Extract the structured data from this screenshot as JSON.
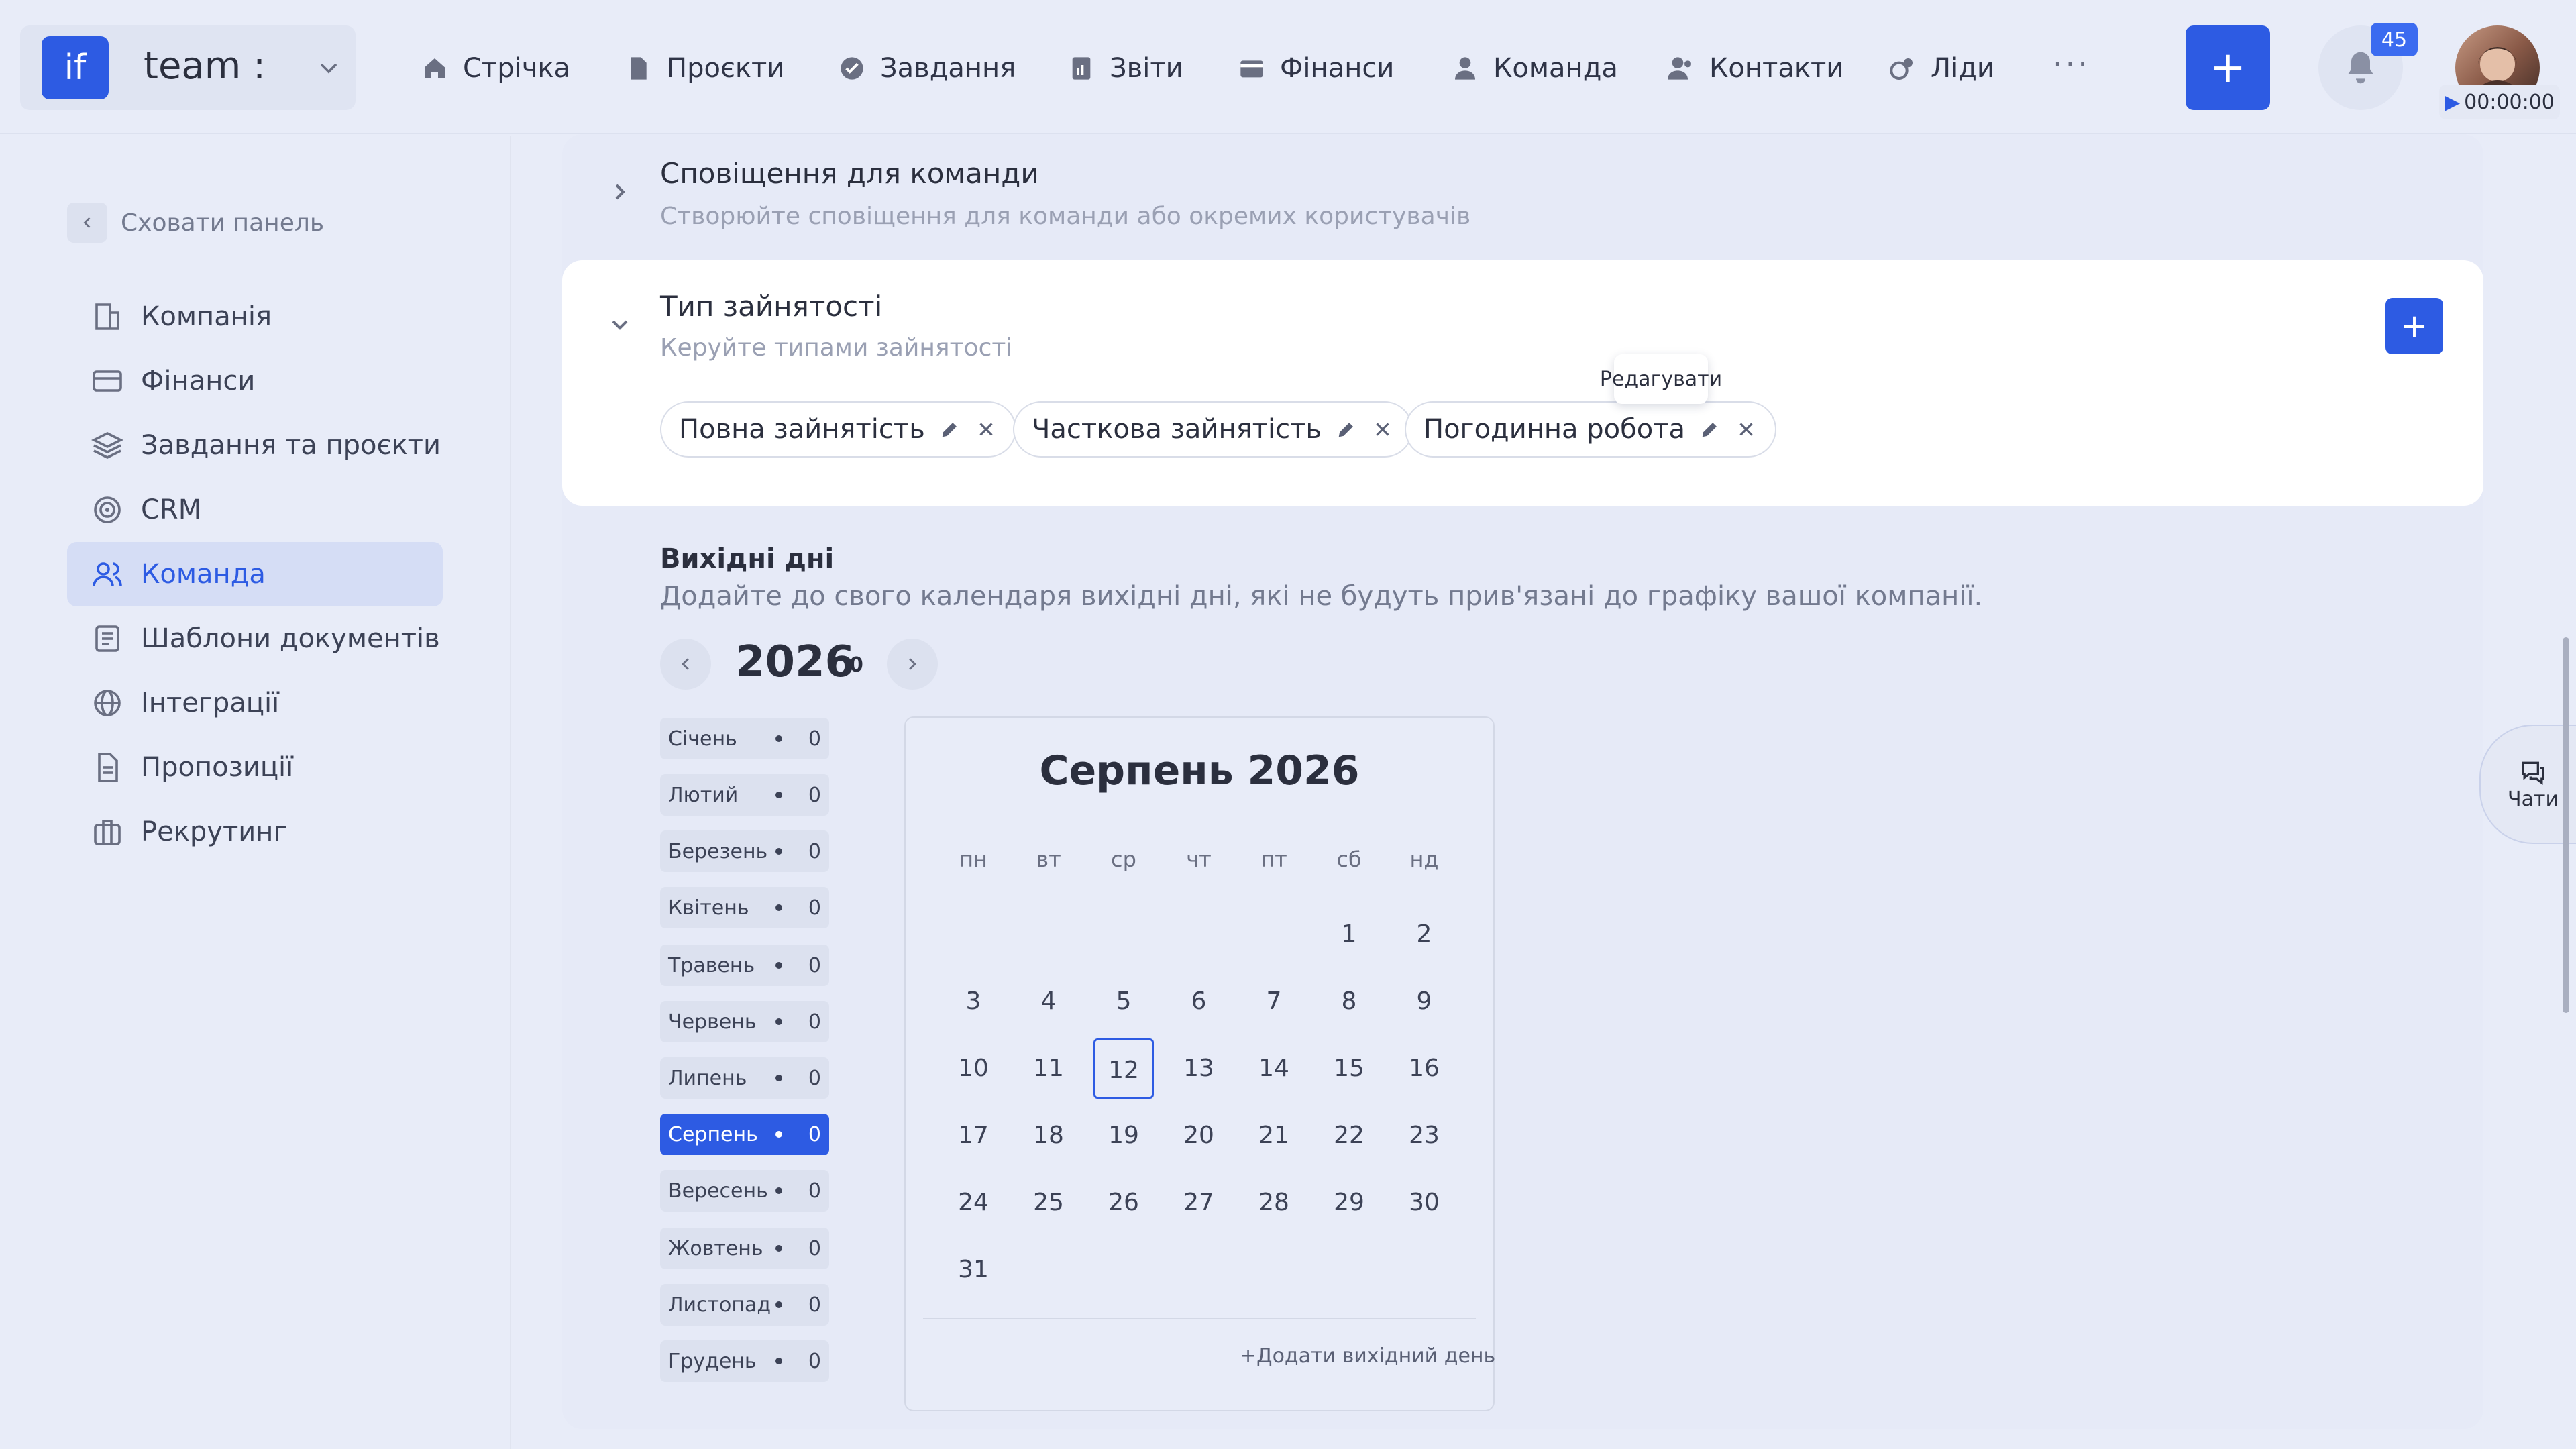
{
  "workspace": {
    "logo": "if",
    "name": "team :"
  },
  "nav": [
    {
      "label": "Стрічка",
      "icon": "home-icon"
    },
    {
      "label": "Проєкти",
      "icon": "document-icon"
    },
    {
      "label": "Завдання",
      "icon": "check-circle-icon"
    },
    {
      "label": "Звіти",
      "icon": "report-icon"
    },
    {
      "label": "Фінанси",
      "icon": "wallet-icon"
    },
    {
      "label": "Команда",
      "icon": "user-icon"
    },
    {
      "label": "Контакти",
      "icon": "contacts-icon"
    },
    {
      "label": "Ліди",
      "icon": "leads-icon"
    }
  ],
  "header": {
    "more": "···",
    "add": "+",
    "notifications_count": "45",
    "timer": "00:00:00"
  },
  "sidebar": {
    "collapse_label": "Сховати панель",
    "items": [
      {
        "label": "Компанія",
        "icon": "company-icon"
      },
      {
        "label": "Фінанси",
        "icon": "card-icon"
      },
      {
        "label": "Завдання та проєкти",
        "icon": "layers-icon"
      },
      {
        "label": "CRM",
        "icon": "target-icon"
      },
      {
        "label": "Команда",
        "icon": "team-icon",
        "active": true
      },
      {
        "label": "Шаблони документів",
        "icon": "template-icon"
      },
      {
        "label": "Інтеграції",
        "icon": "globe-icon"
      },
      {
        "label": "Пропозиції",
        "icon": "file-icon"
      },
      {
        "label": "Рекрутинг",
        "icon": "briefcase-icon"
      }
    ]
  },
  "notifications_section": {
    "title": "Сповіщення для команди",
    "subtitle": "Створюйте сповіщення для команди або окремих користувачів"
  },
  "employment": {
    "title": "Тип зайнятості",
    "subtitle": "Керуйте типами зайнятості",
    "add": "+",
    "chips": [
      "Повна зайнятість",
      "Часткова зайнятість",
      "Погодинна робота"
    ],
    "tooltip": "Редагувати"
  },
  "holidays": {
    "title": "Вихідні дні",
    "subtitle": "Додайте до свого календаря вихідні дні, які не будуть прив'язані до графіку вашої компанії.",
    "year": "2026",
    "year_count": "0",
    "months": [
      {
        "name": "Січень",
        "count": "0"
      },
      {
        "name": "Лютий",
        "count": "0"
      },
      {
        "name": "Березень",
        "count": "0"
      },
      {
        "name": "Квітень",
        "count": "0"
      },
      {
        "name": "Травень",
        "count": "0"
      },
      {
        "name": "Червень",
        "count": "0"
      },
      {
        "name": "Липень",
        "count": "0"
      },
      {
        "name": "Серпень",
        "count": "0",
        "active": true
      },
      {
        "name": "Вересень",
        "count": "0"
      },
      {
        "name": "Жовтень",
        "count": "0"
      },
      {
        "name": "Листопад",
        "count": "0"
      },
      {
        "name": "Грудень",
        "count": "0"
      }
    ],
    "calendar": {
      "title": "Серпень 2026",
      "weekdays": [
        "пн",
        "вт",
        "ср",
        "чт",
        "пт",
        "сб",
        "нд"
      ],
      "first_weekday_index": 5,
      "days_in_month": 31,
      "today": 12,
      "add_label": "+Додати вихідний день"
    }
  },
  "chats": {
    "label": "Чати"
  }
}
